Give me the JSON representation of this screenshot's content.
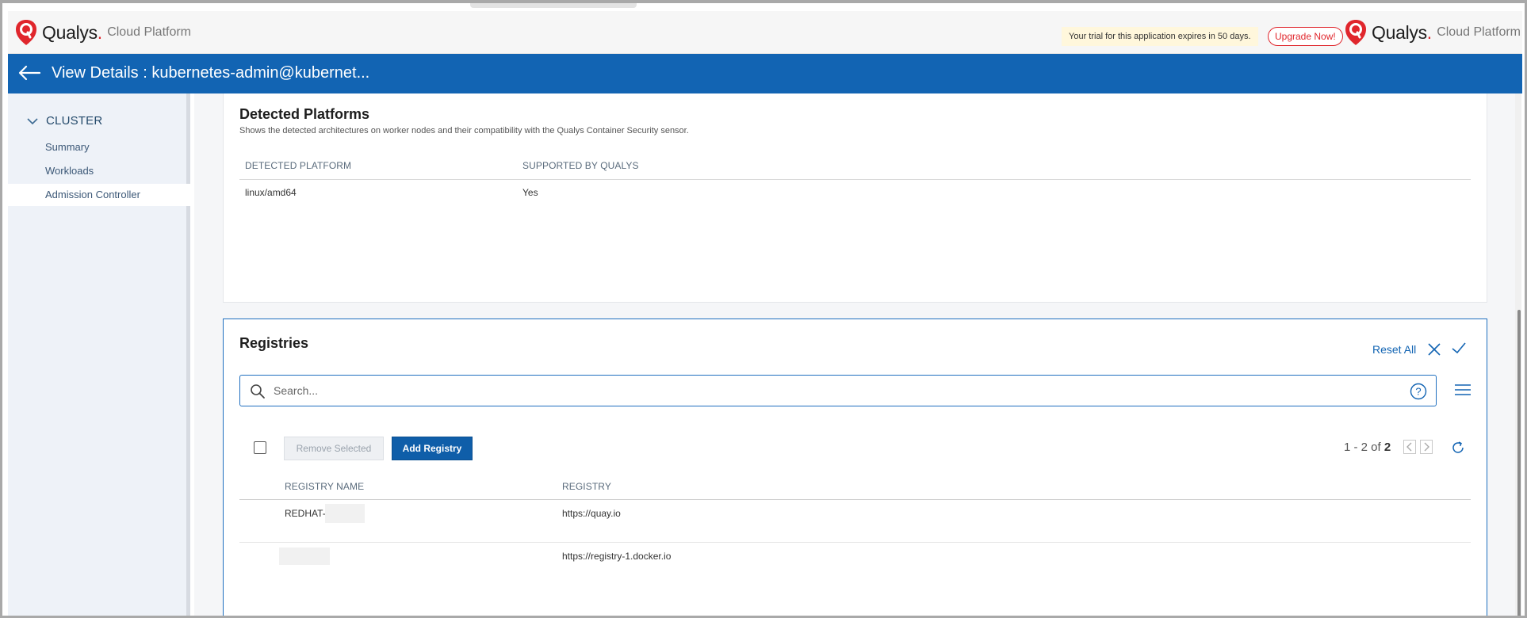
{
  "topbar": {
    "brand": "Qualys",
    "platform": "Cloud Platform",
    "trial_text": "Your trial for this application expires in 50 days.",
    "upgrade_label": "Upgrade Now!"
  },
  "header": {
    "title": "View Details : kubernetes-admin@kubernet..."
  },
  "sidebar": {
    "section": "CLUSTER",
    "items": [
      {
        "label": "Summary"
      },
      {
        "label": "Workloads"
      },
      {
        "label": "Admission Controller",
        "active": true
      }
    ]
  },
  "platforms": {
    "title": "Detected Platforms",
    "subtitle": "Shows the detected architectures on worker nodes and their compatibility with the Qualys Container Security sensor.",
    "columns": [
      "DETECTED PLATFORM",
      "SUPPORTED BY QUALYS"
    ],
    "rows": [
      {
        "platform": "linux/amd64",
        "supported": "Yes"
      }
    ]
  },
  "registries": {
    "title": "Registries",
    "reset_label": "Reset All",
    "search_placeholder": "Search...",
    "remove_label": "Remove Selected",
    "add_label": "Add Registry",
    "pager_range": "1 - 2 of",
    "pager_total": "2",
    "columns": [
      "REGISTRY NAME",
      "REGISTRY"
    ],
    "rows": [
      {
        "name": "REDHAT-",
        "registry": "https://quay.io"
      },
      {
        "name": "",
        "registry": "https://registry-1.docker.io"
      }
    ]
  },
  "colors": {
    "brand_red": "#e0262c",
    "header_blue": "#1264b3",
    "sidebar_bg": "#eef2f8"
  },
  "icons": [
    "qualys-shield-icon",
    "back-arrow-icon",
    "chevron-down-icon",
    "search-icon",
    "help-icon",
    "close-icon",
    "check-icon",
    "menu-icon",
    "chevron-left-icon",
    "chevron-right-icon",
    "refresh-icon"
  ]
}
